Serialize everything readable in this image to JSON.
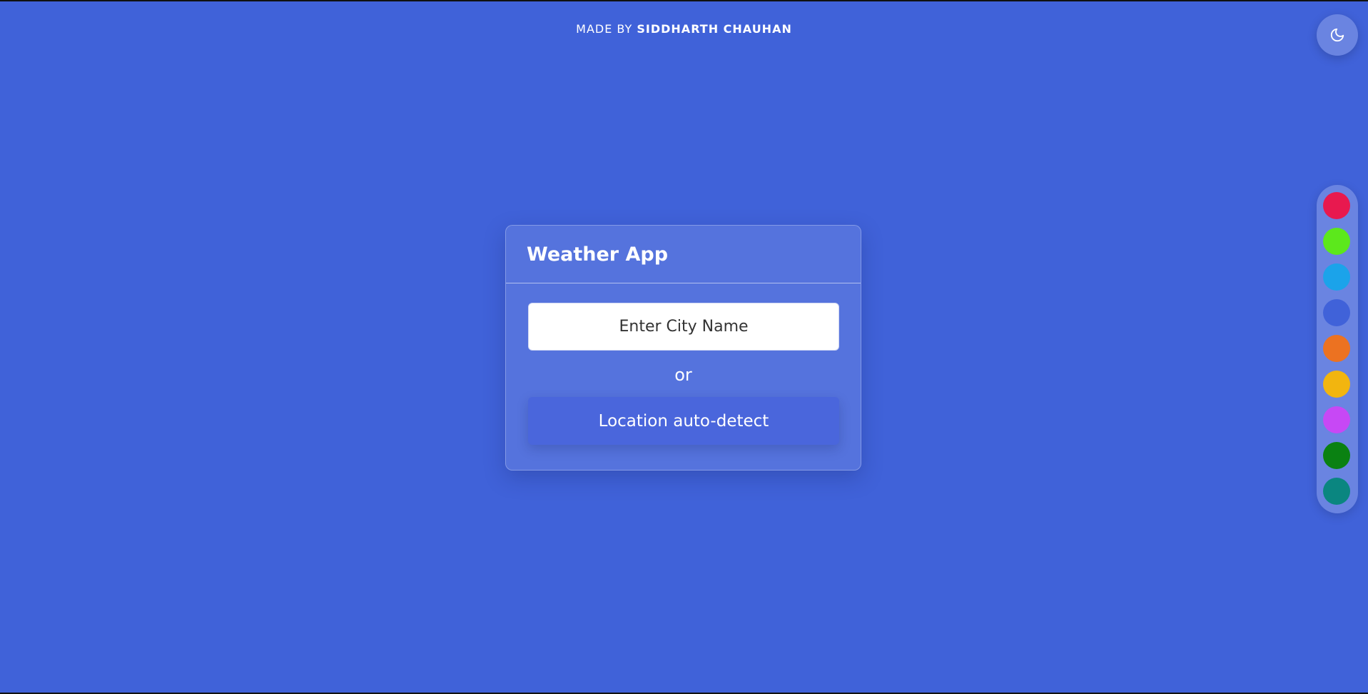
{
  "credit": {
    "prefix": "MADE BY ",
    "author": "SIDDHARTH CHAUHAN"
  },
  "theme_toggle": {
    "icon": "moon-icon"
  },
  "card": {
    "title": "Weather App",
    "city_input_placeholder": "Enter City Name",
    "city_input_value": "",
    "separator": "or",
    "locate_button_label": "Location auto-detect"
  },
  "palette": {
    "colors": [
      "#e8194f",
      "#5ce81c",
      "#1ba3ea",
      "#4062d9",
      "#ec7221",
      "#f2b50f",
      "#c748f5",
      "#0a8112",
      "#0a8680"
    ],
    "selected": "#4062d9"
  },
  "colors": {
    "background": "#4062d9",
    "text": "#ffffff"
  }
}
